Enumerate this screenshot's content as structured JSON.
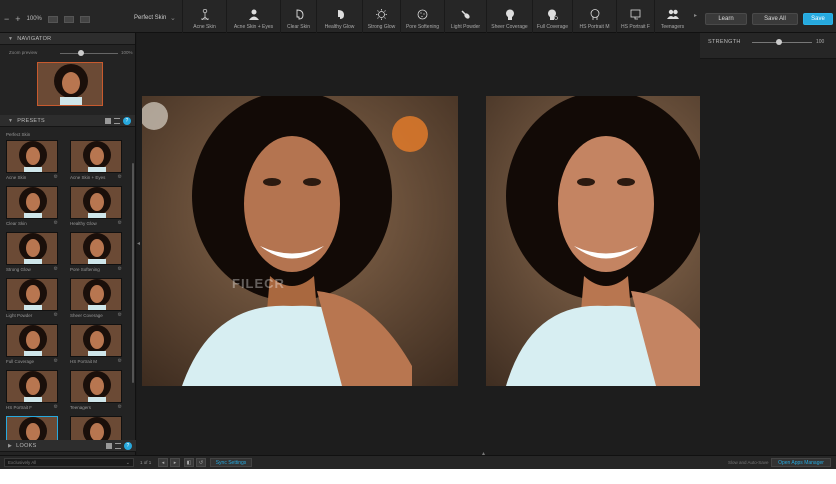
{
  "toolbar": {
    "zoom_minus": "−",
    "zoom_plus": "+",
    "zoom_value": "100%",
    "preset_name": "Perfect Skin",
    "tools": [
      {
        "label": "Acne Skin",
        "icon": "figure-icon"
      },
      {
        "label": "Acne Skin + Eyes",
        "icon": "person-icon"
      },
      {
        "label": "Clear Skin",
        "icon": "face-profile-icon"
      },
      {
        "label": "Healthy Glow",
        "icon": "face-glow-icon"
      },
      {
        "label": "Strong Glow",
        "icon": "sun-face-icon"
      },
      {
        "label": "Pore Softening",
        "icon": "circle-dots-icon"
      },
      {
        "label": "Light Powder",
        "icon": "powder-brush-icon"
      },
      {
        "label": "Sheer Coverage",
        "icon": "face-solid-icon"
      },
      {
        "label": "Full Coverage",
        "icon": "face-gear-icon"
      },
      {
        "label": "HS Portrait M",
        "icon": "head-outline-icon"
      },
      {
        "label": "HS Portrait F",
        "icon": "frame-icon"
      },
      {
        "label": "Teenagers",
        "icon": "group-icon"
      }
    ],
    "learn_label": "Learn",
    "save_all_label": "Save All",
    "save_label": "Save",
    "accent": "#27a9de"
  },
  "navigator": {
    "title": "NAVIGATOR",
    "zoom_label": "Zoom preview",
    "zoom_value": "100%"
  },
  "presets": {
    "title": "PRESETS",
    "group": "Perfect Skin",
    "items": [
      {
        "label": "Acne Skin"
      },
      {
        "label": "Acne Skin + Eyes"
      },
      {
        "label": "Clear Skin"
      },
      {
        "label": "Healthy Glow"
      },
      {
        "label": "Strong Glow"
      },
      {
        "label": "Pore Softening"
      },
      {
        "label": "Light Powder"
      },
      {
        "label": "Sheer Coverage"
      },
      {
        "label": "Full Coverage"
      },
      {
        "label": "HS Portrait M"
      },
      {
        "label": "HS Portrait F"
      },
      {
        "label": "Teenagers"
      },
      {
        "label": ""
      },
      {
        "label": ""
      }
    ],
    "help": "?"
  },
  "looks": {
    "title": "LOOKS",
    "help": "?"
  },
  "strength": {
    "label": "STRENGTH",
    "value": "100",
    "level": 0.45
  },
  "canvas": {
    "watermark": "FILECR"
  },
  "bottom": {
    "select_value": "Exclusively All",
    "page": "1 of 1",
    "sync_label": "Sync Settings",
    "right_text": "Slow and Auto-Save",
    "open_label": "Open Apps Manager"
  }
}
